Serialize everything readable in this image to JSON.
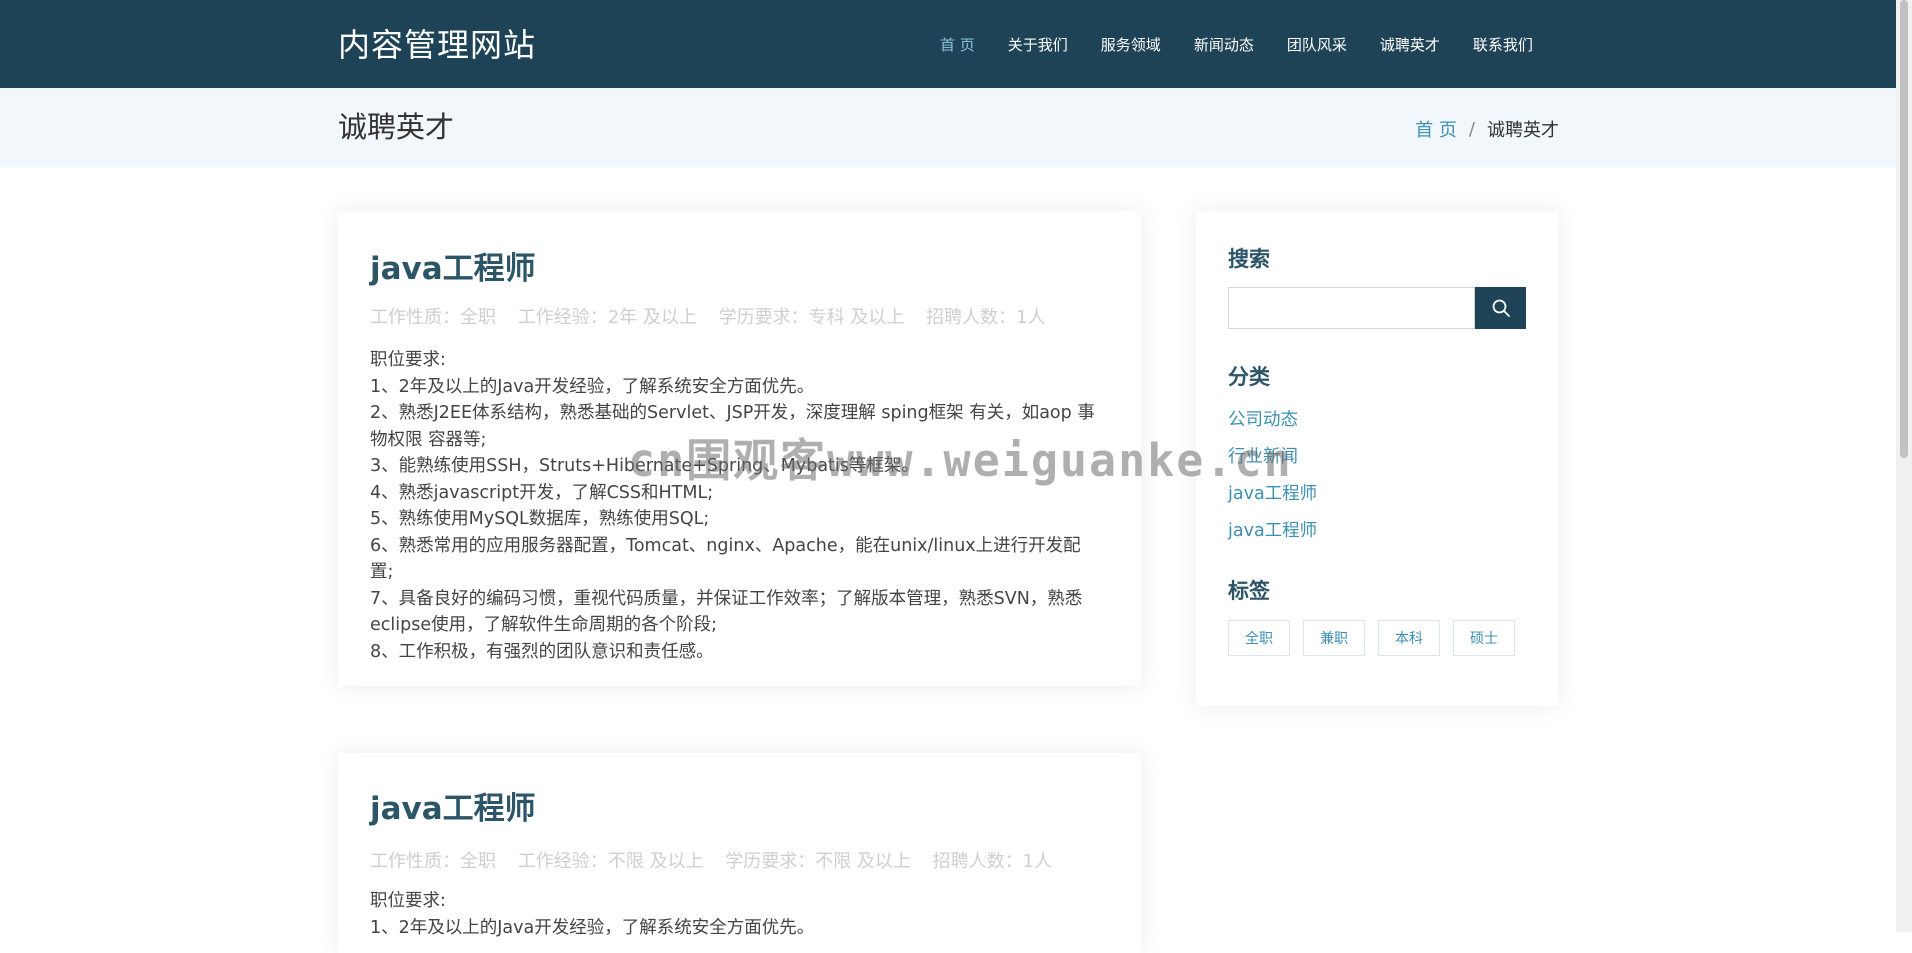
{
  "header": {
    "logo": "内容管理网站",
    "nav": [
      "首 页",
      "关于我们",
      "服务领域",
      "新闻动态",
      "团队风采",
      "诚聘英才",
      "联系我们"
    ]
  },
  "page": {
    "title": "诚聘英才",
    "breadcrumb": {
      "home": "首 页",
      "sep": "/",
      "current": "诚聘英才"
    }
  },
  "jobs": [
    {
      "title": "java工程师",
      "meta": [
        "工作性质：全职",
        "工作经验：2年 及以上",
        "学历要求：专科 及以上",
        "招聘人数：1人"
      ],
      "requirements": [
        "职位要求:",
        "1、2年及以上的Java开发经验，了解系统安全方面优先。",
        "2、熟悉J2EE体系结构，熟悉基础的Servlet、JSP开发，深度理解 sping框架 有关，如aop 事物权限 容器等;",
        "3、能熟练使用SSH，Struts+Hibernate+Spring、Mybatis等框架。",
        "4、熟悉javascript开发，了解CSS和HTML;",
        "5、熟练使用MySQL数据库，熟练使用SQL;",
        "6、熟悉常用的应用服务器配置，Tomcat、nginx、Apache，能在unix/linux上进行开发配置;",
        "7、具备良好的编码习惯，重视代码质量，并保证工作效率；了解版本管理，熟悉SVN，熟悉eclipse使用，了解软件生命周期的各个阶段;",
        "8、工作积极，有强烈的团队意识和责任感。"
      ]
    },
    {
      "title": "java工程师",
      "meta": [
        "工作性质：全职",
        "工作经验：不限 及以上",
        "学历要求：不限 及以上",
        "招聘人数：1人"
      ],
      "requirements": [
        "职位要求:",
        "1、2年及以上的Java开发经验，了解系统安全方面优先。"
      ]
    }
  ],
  "sidebar": {
    "search_heading": "搜索",
    "search_value": "",
    "category_heading": "分类",
    "categories": [
      "公司动态",
      "行业新闻",
      "java工程师",
      "java工程师"
    ],
    "tags_heading": "标签",
    "tags": [
      "全职",
      "兼职",
      "本科",
      "硕士"
    ]
  },
  "watermark": "cn围观客www.weiguanke.cn",
  "colors": {
    "header_bg": "#1e4356",
    "accent": "#3d8fb3",
    "heading": "#2d5568"
  },
  "icons": {
    "search": "search-icon"
  }
}
